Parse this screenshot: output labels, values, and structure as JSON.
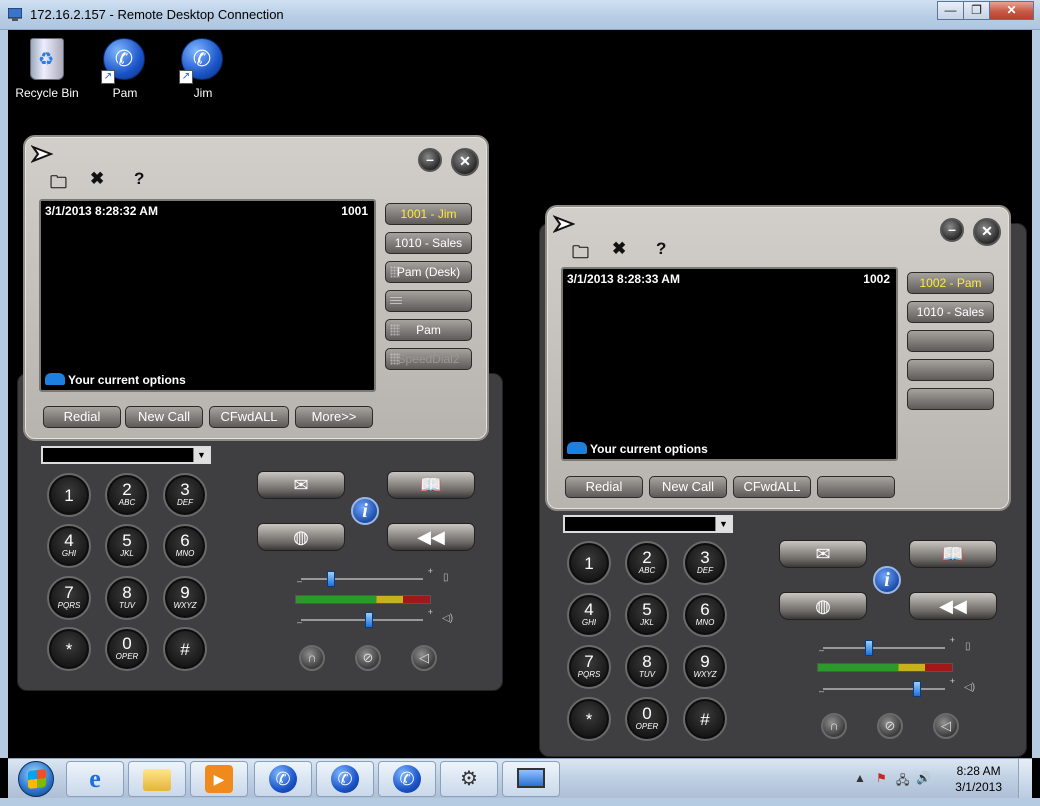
{
  "window": {
    "title": "172.16.2.157 - Remote Desktop Connection",
    "controls": {
      "minimize": "—",
      "restore": "❐",
      "close": "✕"
    }
  },
  "desktop": {
    "icons": [
      {
        "label": "Recycle Bin",
        "icon": "recycle-bin-icon"
      },
      {
        "label": "Pam",
        "icon": "phone-shortcut-icon"
      },
      {
        "label": "Jim",
        "icon": "phone-shortcut-icon"
      }
    ]
  },
  "phones": [
    {
      "name": "phone-jim",
      "screen": {
        "datetime": "3/1/2013 8:28:32 AM",
        "extension": "1001",
        "options": "Your current options"
      },
      "lines": [
        {
          "label": "1001 - Jim",
          "state": "active"
        },
        {
          "label": "1010 - Sales",
          "state": "normal"
        },
        {
          "label": "Pam (Desk)",
          "state": "normal",
          "icon": "grid"
        },
        {
          "label": "",
          "state": "normal",
          "icon": "lines"
        },
        {
          "label": "Pam",
          "state": "normal",
          "icon": "grid"
        },
        {
          "label": "SpeedDial2",
          "state": "disabled",
          "icon": "grid"
        }
      ],
      "softkeys": [
        "Redial",
        "New Call",
        "CFwdALL",
        "More>>"
      ]
    },
    {
      "name": "phone-pam",
      "screen": {
        "datetime": "3/1/2013 8:28:33 AM",
        "extension": "1002",
        "options": "Your current options"
      },
      "lines": [
        {
          "label": "1002 - Pam",
          "state": "active"
        },
        {
          "label": "1010 - Sales",
          "state": "normal"
        },
        {
          "label": "",
          "state": "normal"
        },
        {
          "label": "",
          "state": "normal"
        },
        {
          "label": "",
          "state": "normal"
        }
      ],
      "softkeys": [
        "Redial",
        "New Call",
        "CFwdALL",
        ""
      ]
    }
  ],
  "keypad": [
    {
      "digit": "1",
      "letters": ""
    },
    {
      "digit": "2",
      "letters": "ABC"
    },
    {
      "digit": "3",
      "letters": "DEF"
    },
    {
      "digit": "4",
      "letters": "GHI"
    },
    {
      "digit": "5",
      "letters": "JKL"
    },
    {
      "digit": "6",
      "letters": "MNO"
    },
    {
      "digit": "7",
      "letters": "PQRS"
    },
    {
      "digit": "8",
      "letters": "TUV"
    },
    {
      "digit": "9",
      "letters": "WXYZ"
    },
    {
      "digit": "*",
      "letters": ""
    },
    {
      "digit": "0",
      "letters": "OPER"
    },
    {
      "digit": "#",
      "letters": ""
    }
  ],
  "taskbar": {
    "items": [
      "internet-explorer",
      "windows-explorer",
      "media-player",
      "phone-app-1",
      "phone-app-2",
      "phone-app-3",
      "management-console",
      "remote-desktop"
    ],
    "clock": {
      "time": "8:28 AM",
      "date": "3/1/2013"
    }
  },
  "colors": {
    "active_line": "#ffea3a",
    "screen_bg": "#000000",
    "phone_shell": "#c4c0bb",
    "taskbar": "#c0d1e4"
  }
}
